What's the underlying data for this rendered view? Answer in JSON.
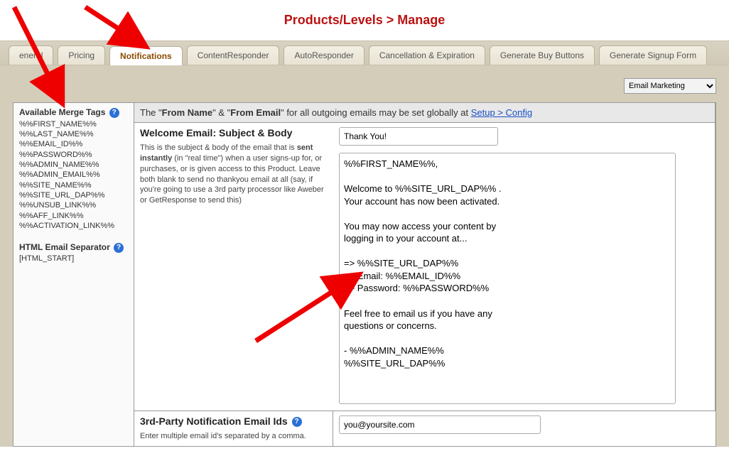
{
  "page_title": "Products/Levels > Manage",
  "tabs": [
    "eneral",
    "Pricing",
    "Notifications",
    "ContentResponder",
    "AutoResponder",
    "Cancellation & Expiration",
    "Generate Buy Buttons",
    "Generate Signup Form"
  ],
  "active_tab_index": 2,
  "dropdown": {
    "selected": "Email Marketing"
  },
  "sidebar": {
    "merge_tags_heading": "Available Merge Tags",
    "merge_tags": [
      "%%FIRST_NAME%%",
      "%%LAST_NAME%%",
      "%%EMAIL_ID%%",
      "%%PASSWORD%%",
      "%%ADMIN_NAME%%",
      "%%ADMIN_EMAIL%%",
      "%%SITE_NAME%%",
      "%%SITE_URL_DAP%%",
      "%%UNSUB_LINK%%",
      "%%AFF_LINK%%",
      "%%ACTIVATION_LINK%%"
    ],
    "html_sep_heading": "HTML Email Separator",
    "html_sep_value": "[HTML_START]"
  },
  "banner": {
    "prefix": "The \"",
    "from_name": "From Name",
    "mid": "\" & \"",
    "from_email": "From Email",
    "suffix": "\" for all outgoing emails may be set globally at ",
    "link_text": "Setup > Config"
  },
  "welcome": {
    "title": "Welcome Email: Subject & Body",
    "desc_prefix": "This is the subject & body of the email that is ",
    "desc_bold": "sent instantly",
    "desc_suffix": " (in \"real time\") when a user signs-up for, or purchases, or is given access to this Product. Leave both blank to send no thankyou email at all (say, if you're going to use a 3rd party processor like Aweber or GetResponse to send this)",
    "subject_value": "Thank You!",
    "body_value": "%%FIRST_NAME%%,\n\nWelcome to %%SITE_URL_DAP%% .\nYour account has now been activated.\n\nYou may now access your content by\nlogging in to your account at...\n\n=> %%SITE_URL_DAP%%\n=> Email: %%EMAIL_ID%%\n=> Password: %%PASSWORD%%\n\nFeel free to email us if you have any\nquestions or concerns.\n\n- %%ADMIN_NAME%%\n%%SITE_URL_DAP%%"
  },
  "third_party": {
    "title": "3rd-Party Notification Email Ids",
    "desc": "Enter multiple email id's separated by a comma.",
    "value": "you@yoursite.com"
  }
}
